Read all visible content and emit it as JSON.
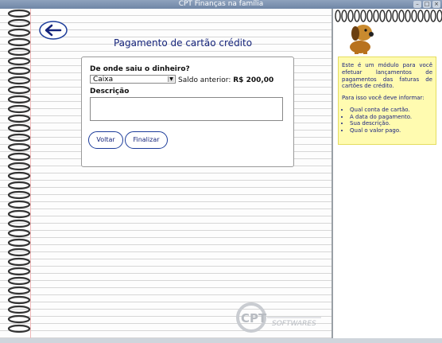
{
  "window": {
    "title": "CPT Finanças na família"
  },
  "page": {
    "title": "Pagamento de cartão crédito"
  },
  "form": {
    "source_label": "De onde saiu o dinheiro?",
    "source_selected": "Caixa",
    "balance_label": "Saldo anterior:",
    "balance_value": "R$ 200,00",
    "description_label": "Descrição",
    "description_value": "",
    "back_label": "Voltar",
    "finish_label": "Finalizar"
  },
  "help": {
    "intro": "Este é um módulo para você efetuar lançamentos de pagamentos das faturas de cartões de crédito.",
    "prompt": "Para isso você deve informar:",
    "items": [
      "Qual conta de cartão.",
      "A data do pagamento.",
      "Sua descrição.",
      "Qual o valor pago."
    ]
  },
  "logo": {
    "brand": "CPT",
    "sub": "SOFTWARES"
  },
  "icons": {
    "back": "back-arrow-icon",
    "mascot": "dog-mascot-icon"
  }
}
